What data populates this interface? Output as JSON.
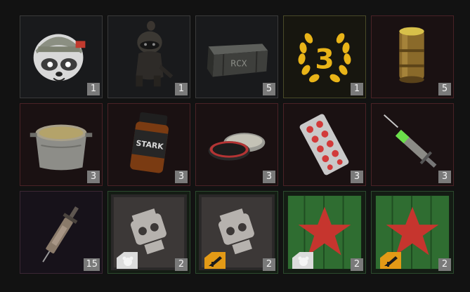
{
  "items": [
    {
      "name": "Raccoon helmet sticker",
      "count": "1",
      "rarity": "none",
      "icon": "raccoon-helmet-icon"
    },
    {
      "name": "Raccoon figurine",
      "count": "1",
      "rarity": "none",
      "icon": "raccoon-figurine-icon"
    },
    {
      "name": "Rock crate",
      "count": "5",
      "rarity": "none",
      "label": "RCX",
      "icon": "crate-icon"
    },
    {
      "name": "Level 3 laurel",
      "count": "1",
      "rarity": "gold",
      "label": "3",
      "icon": "laurel-icon"
    },
    {
      "name": "Wooden canister",
      "count": "5",
      "rarity": "red",
      "icon": "canister-icon"
    },
    {
      "name": "Cooking pot",
      "count": "3",
      "rarity": "red",
      "icon": "pot-icon"
    },
    {
      "name": "Stark jar",
      "count": "3",
      "rarity": "red",
      "label": "STARK",
      "icon": "jar-icon"
    },
    {
      "name": "Ointment tin",
      "count": "3",
      "rarity": "red",
      "icon": "tin-icon"
    },
    {
      "name": "Pill blister",
      "count": "3",
      "rarity": "red",
      "icon": "pills-icon"
    },
    {
      "name": "Green syringe",
      "count": "3",
      "rarity": "red",
      "icon": "syringe-icon"
    },
    {
      "name": "Large syringe",
      "count": "15",
      "rarity": "purple",
      "icon": "big-syringe-icon"
    },
    {
      "name": "Raccoon camo pattern",
      "count": "2",
      "rarity": "green",
      "badge": "white",
      "icon": "camo-raccoon-icon"
    },
    {
      "name": "Raccoon camo pattern",
      "count": "2",
      "rarity": "green",
      "badge": "orange",
      "icon": "camo-raccoon-icon"
    },
    {
      "name": "Red star camo",
      "count": "2",
      "rarity": "green",
      "badge": "white",
      "icon": "camo-star-icon"
    },
    {
      "name": "Red star camo",
      "count": "2",
      "rarity": "green",
      "badge": "orange",
      "icon": "camo-star-icon"
    }
  ]
}
